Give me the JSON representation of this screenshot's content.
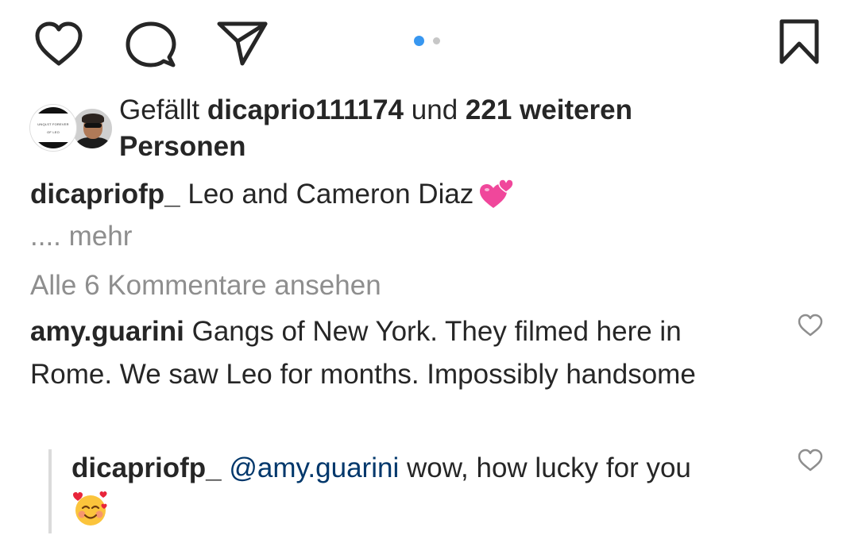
{
  "actions": {
    "like_icon": "heart-outline-icon",
    "comment_icon": "comment-bubble-icon",
    "share_icon": "paper-plane-icon",
    "save_icon": "bookmark-icon"
  },
  "carousel": {
    "current_index": 1,
    "total": 2,
    "active_color": "#3897f0"
  },
  "likes": {
    "prefix": "Gefällt",
    "user": "dicaprio111174",
    "middle": "und",
    "count": "221 weiteren",
    "suffix": "Personen",
    "avatar_left_line1": "UNQLST FOREVER",
    "avatar_left_line2": "OF LEO"
  },
  "caption": {
    "username": "dicapriofp_",
    "text": "Leo and Cameron Diaz",
    "emoji": "two-hearts-emoji",
    "more_prefix": "....",
    "more_label": "mehr"
  },
  "view_all_comments": "Alle 6 Kommentare ansehen",
  "comments": [
    {
      "username": "amy.guarini",
      "text": "Gangs of New York. They filmed here in Rome. We saw Leo for months. Impossibly handsome"
    }
  ],
  "replies": [
    {
      "username": "dicapriofp_",
      "mention": "@amy.guarini",
      "text": "wow, how lucky for you",
      "emoji": "smiling-face-with-hearts-emoji"
    }
  ]
}
